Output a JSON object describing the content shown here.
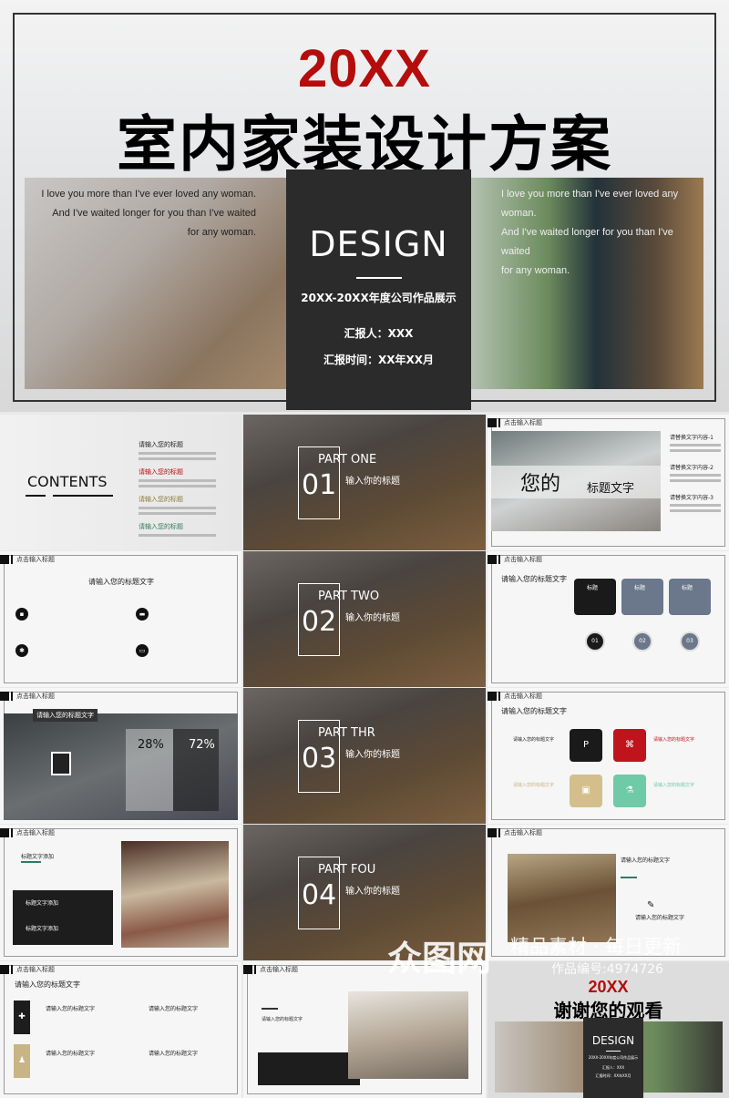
{
  "hero": {
    "year": "20XX",
    "title": "室内家装设计方案",
    "quote_left": [
      "I love you more than I've ever loved any woman.",
      "And I've waited longer for you than I've waited",
      "for any woman."
    ],
    "quote_right": [
      "I love you more than I've ever loved any woman.",
      "And I've waited longer for you than I've waited",
      "for any woman."
    ],
    "card": {
      "heading": "DESIGN",
      "subtitle": "20XX-20XX年度公司作品展示",
      "reporter": "汇报人：XXX",
      "time": "汇报时间：XX年XX月"
    }
  },
  "common": {
    "slide_header": "点击输入标题",
    "title_text": "请输入您的标题文字",
    "input_title": "请输入您的标题",
    "input_your_title": "输入你的标题"
  },
  "contents": {
    "label": "CONTENTS",
    "items": [
      {
        "label": "请输入您的标题",
        "color": "#222222"
      },
      {
        "label": "请输入您的标题",
        "color": "#b50c0c"
      },
      {
        "label": "请输入您的标题",
        "color": "#8a7a3a"
      },
      {
        "label": "请输入您的标题",
        "color": "#2f7a5a"
      }
    ]
  },
  "parts": [
    {
      "label": "PART ONE",
      "num": "01"
    },
    {
      "label": "PART TWO",
      "num": "02"
    },
    {
      "label": "PART THR",
      "num": "03"
    },
    {
      "label": "PART FOU",
      "num": "04"
    }
  ],
  "slide_photo_title": {
    "big": "您的",
    "small": "标题文字",
    "items": [
      "请替换文字内容-1",
      "请替换文字内容-2",
      "请替换文字内容-3"
    ]
  },
  "steps": {
    "cards": [
      "标题",
      "标题",
      "标题"
    ],
    "nums": [
      "01",
      "02",
      "03"
    ],
    "colors": [
      "#1a1a1a",
      "#6b778a",
      "#6b778a"
    ]
  },
  "stats": {
    "label": "请输入您的标题文字",
    "values": [
      "28%",
      "72%"
    ],
    "progress": [
      28,
      72
    ]
  },
  "tiles": {
    "colors": [
      "#1a1a1a",
      "#c0141c",
      "#d4bf8c",
      "#6fcaa8"
    ],
    "icons": [
      "ppt-icon",
      "sitemap-icon",
      "image-icon",
      "flask-icon"
    ],
    "labels": [
      "请输入您的标题文字",
      "请输入您的标题文字",
      "请输入您的标题文字",
      "请输入您的标题文字"
    ]
  },
  "slide_add": {
    "title": "标题文字添加",
    "items": [
      "标题文字添加",
      "标题文字添加"
    ]
  },
  "thanks": {
    "year": "20XX",
    "title": "谢谢您的观看",
    "heading": "DESIGN",
    "subtitle": "20XX-20XX年度公司作品展示",
    "reporter": "汇报人：XXX",
    "time": "汇报时间：XX年XX月"
  },
  "watermark": {
    "brand": "众图网",
    "slogan": "精品素材 · 每日更新",
    "id": "作品编号:4974726"
  }
}
